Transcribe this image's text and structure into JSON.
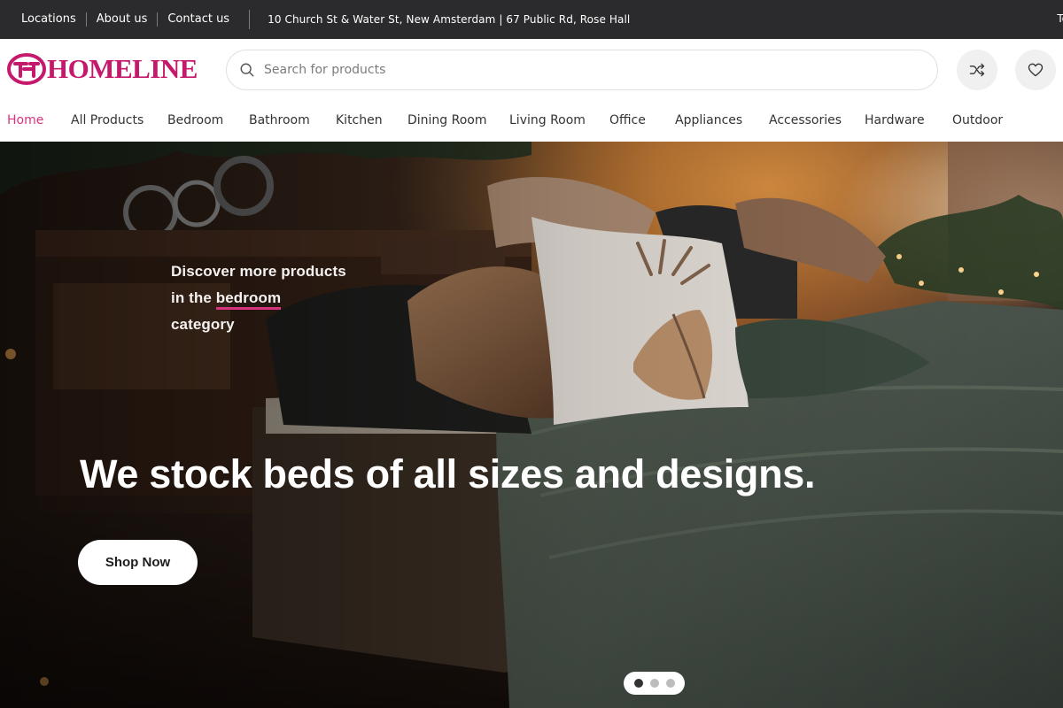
{
  "topbar": {
    "links": [
      "Locations",
      "About us",
      "Contact us"
    ],
    "address": "10 Church St & Water St, New Amsterdam | 67 Public Rd, Rose Hall",
    "right_text": "Te"
  },
  "header": {
    "logo_text": "HOMELINE",
    "search_placeholder": "Search for products",
    "brand_color": "#c51a6c"
  },
  "nav": {
    "items": [
      "Home",
      "All Products",
      "Bedroom",
      "Bathroom",
      "Kitchen",
      "Dining Room",
      "Living Room",
      "Office",
      "Appliances",
      "Accessories",
      "Hardware",
      "Outdoor"
    ],
    "active": "Home"
  },
  "hero": {
    "subtitle_line1": "Discover more products",
    "subtitle_line2_prefix": "in the ",
    "subtitle_highlight": "bedroom",
    "subtitle_line3": "category",
    "title": "We stock beds of all sizes and designs.",
    "button_label": "Shop Now",
    "slides_total": 3,
    "active_slide": 1
  }
}
